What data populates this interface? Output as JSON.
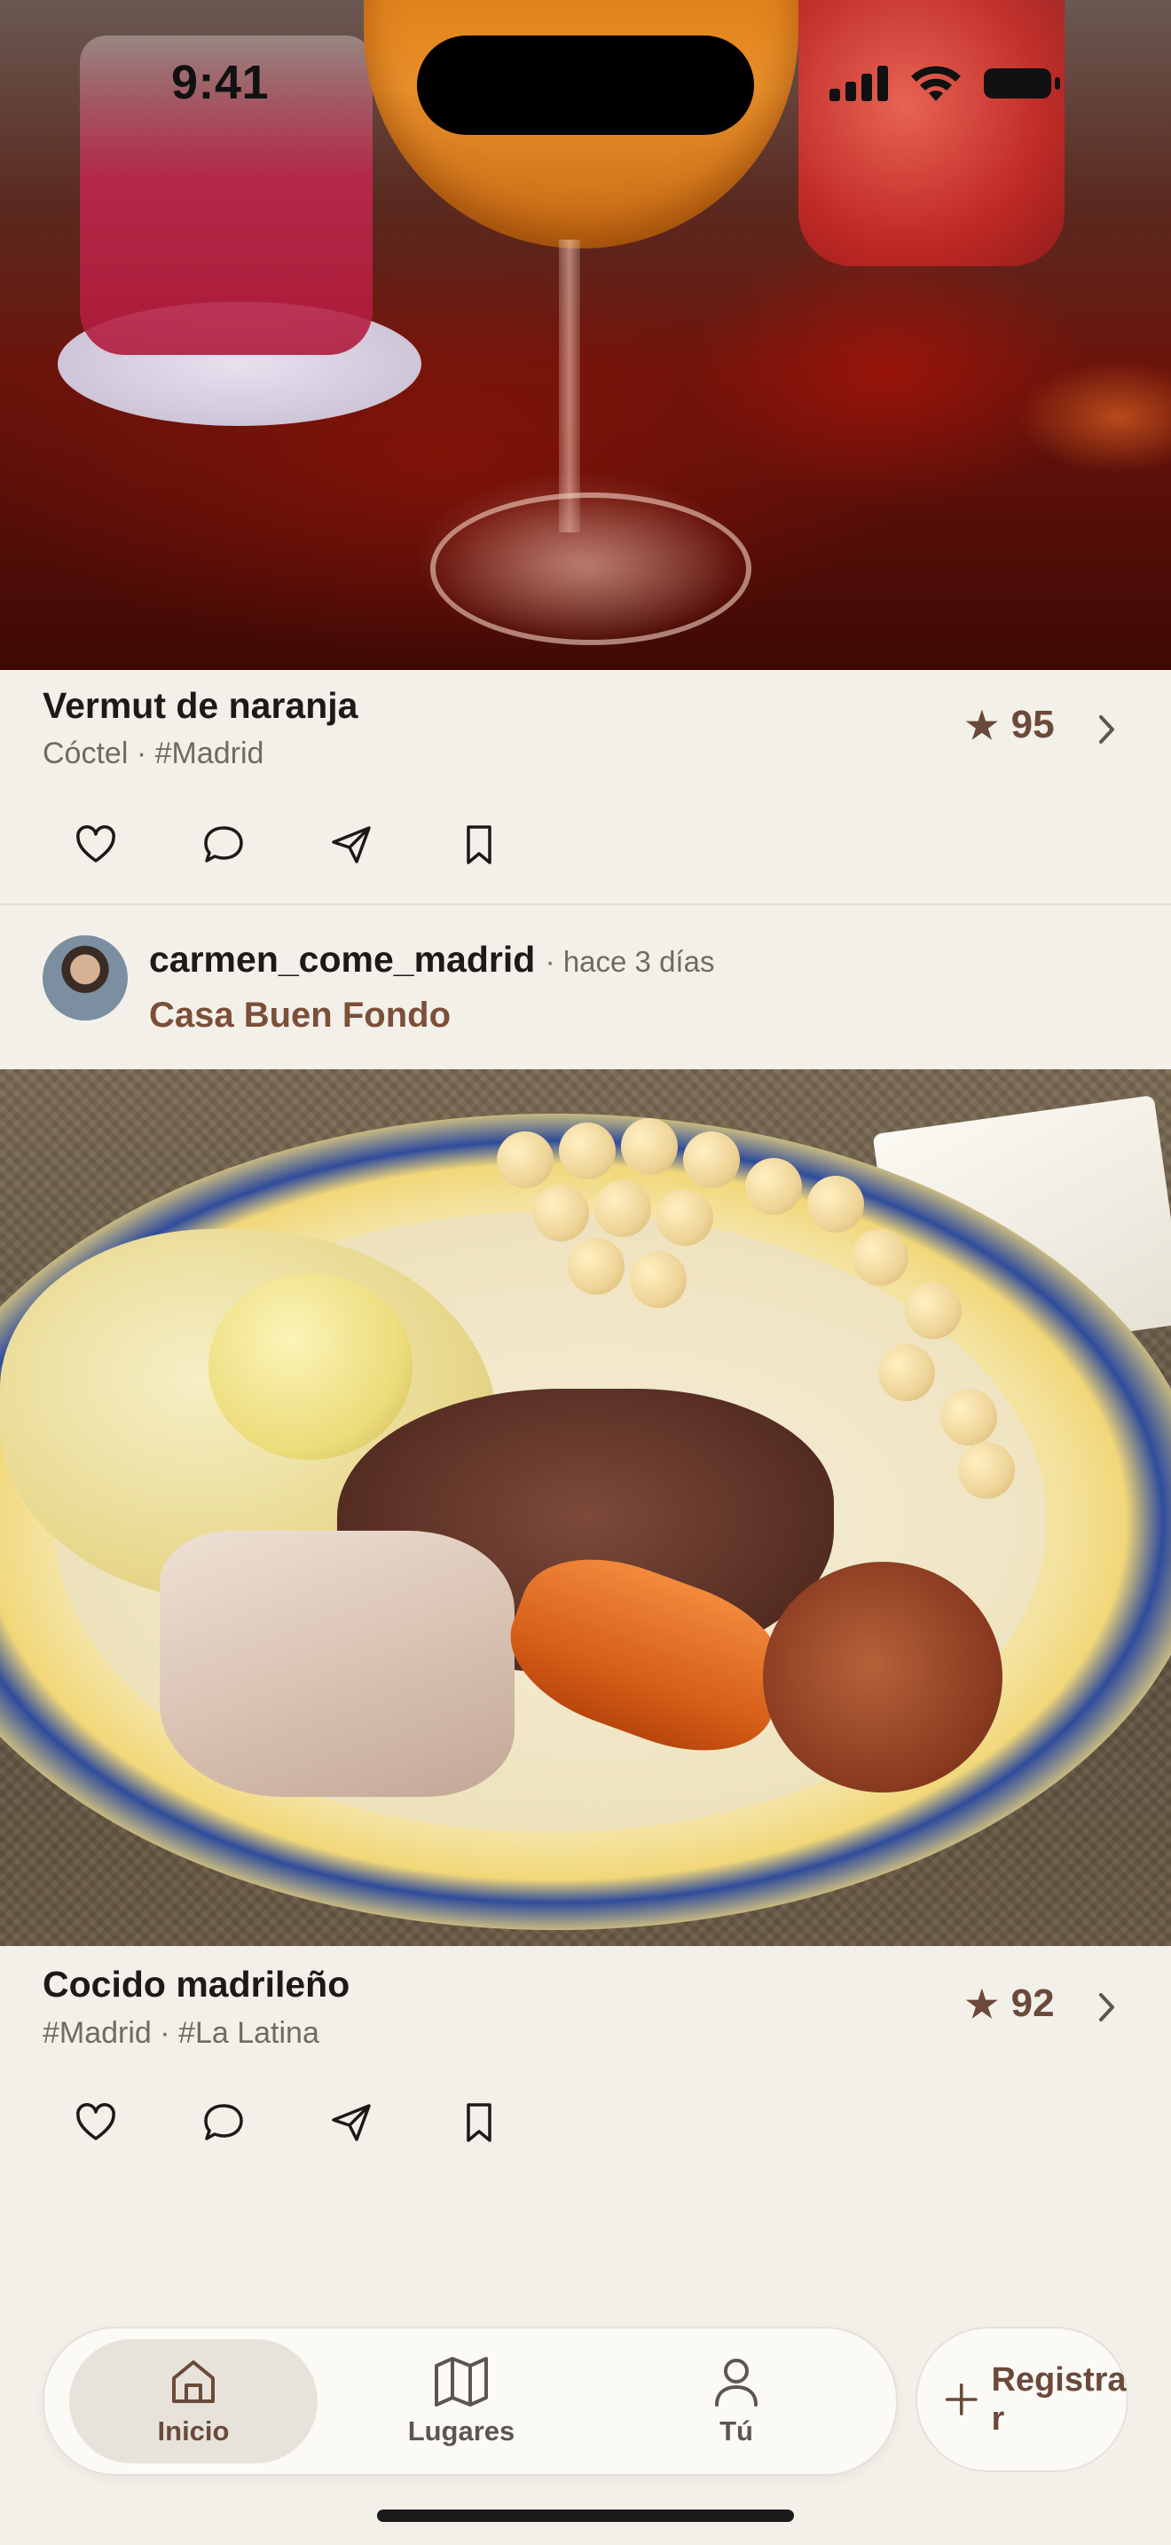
{
  "status_bar": {
    "time": "9:41"
  },
  "posts": [
    {
      "title": "Vermut de naranja",
      "subtitle": "Cóctel · #Madrid",
      "rating": "95"
    },
    {
      "author": "carmen_come_madrid",
      "time_ago": "· hace 3 días",
      "place": "Casa Buen Fondo",
      "title": "Cocido madrileño",
      "subtitle": "#Madrid · #La Latina",
      "rating": "92"
    }
  ],
  "tabbar": {
    "tabs": [
      {
        "label": "Inicio",
        "icon": "home-icon",
        "active": true
      },
      {
        "label": "Lugares",
        "icon": "map-icon",
        "active": false
      },
      {
        "label": "Tú",
        "icon": "person-icon",
        "active": false
      }
    ],
    "register_label": "Registrar"
  },
  "colors": {
    "background": "#f3f0ea",
    "accent_brown": "#6b4a3a",
    "place_brown": "#7b4f38",
    "muted_text": "#6f6a64"
  }
}
